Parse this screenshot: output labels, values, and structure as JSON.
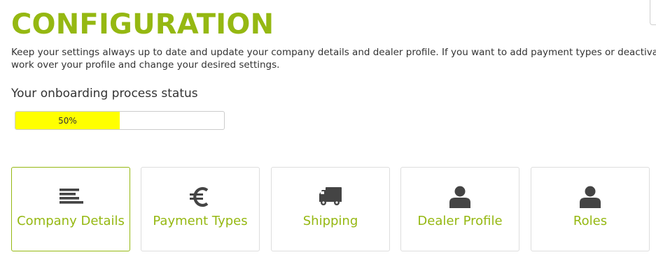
{
  "colors": {
    "accent": "#95b812",
    "progress_fill": "#ffff00",
    "icon": "#444444",
    "text": "#333333",
    "border": "#dddddd"
  },
  "header": {
    "title": "CONFIGURATION",
    "description_line1": "Keep your settings always up to date and update your company details and dealer profile. If you want to add payment types or deactivate ship",
    "description_line2": "work over your profile and change your desired settings."
  },
  "onboarding": {
    "heading": "Your onboarding process status",
    "progress_percent": 50,
    "progress_label": "50%"
  },
  "tiles": [
    {
      "label": "Company Details",
      "icon": "list-icon",
      "active": true
    },
    {
      "label": "Payment Types",
      "icon": "euro-icon",
      "active": false
    },
    {
      "label": "Shipping",
      "icon": "truck-icon",
      "active": false
    },
    {
      "label": "Dealer Profile",
      "icon": "user-icon",
      "active": false
    },
    {
      "label": "Roles",
      "icon": "user-icon",
      "active": false
    }
  ]
}
